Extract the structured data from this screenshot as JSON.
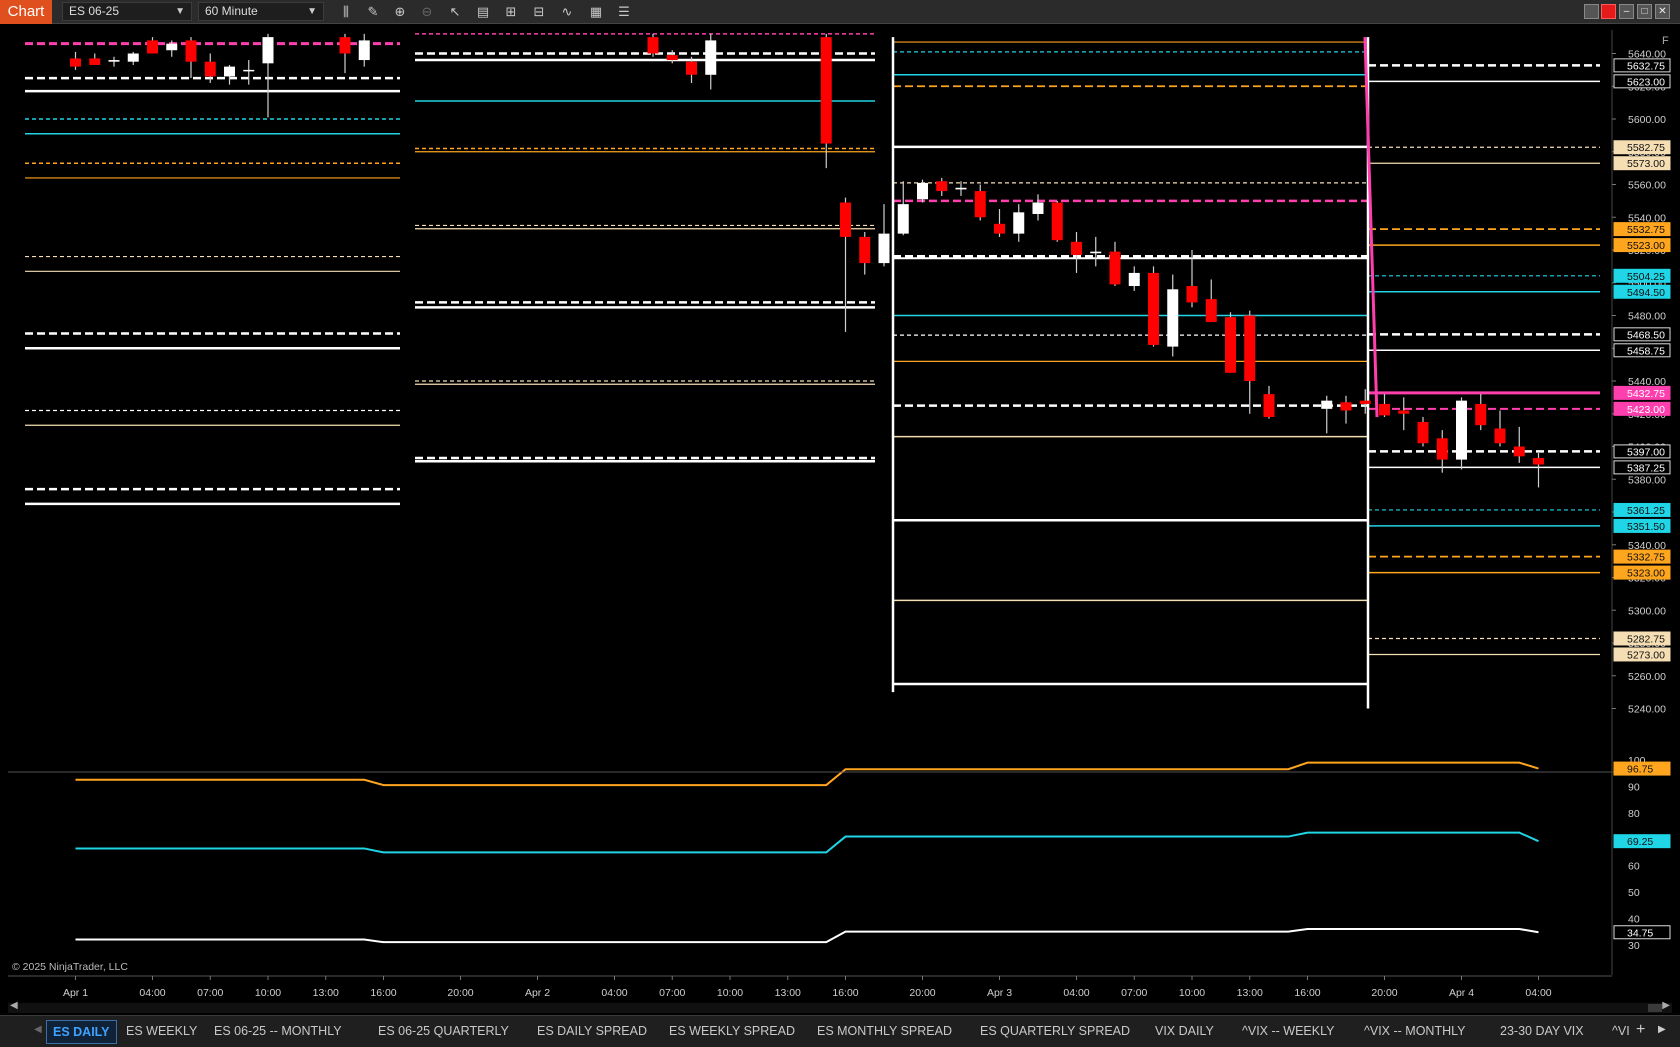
{
  "toolbar": {
    "chart_tab": "Chart",
    "instrument": "ES 06-25",
    "interval": "60 Minute"
  },
  "price_axis": {
    "ticks": [
      "5640.00",
      "5620.00",
      "5600.00",
      "5580.00",
      "5560.00",
      "5540.00",
      "5520.00",
      "5500.00",
      "5480.00",
      "5460.00",
      "5440.00",
      "5420.00",
      "5400.00",
      "5380.00",
      "5360.00",
      "5340.00",
      "5320.00",
      "5300.00",
      "5280.00",
      "5260.00",
      "5240.00"
    ],
    "markers": [
      {
        "label": "5632.75",
        "color": "#ffffff"
      },
      {
        "label": "5623.00",
        "color": "#ffffff"
      },
      {
        "label": "5582.75",
        "color": "#f5deb3"
      },
      {
        "label": "5573.00",
        "color": "#f5deb3"
      },
      {
        "label": "5532.75",
        "color": "#ffa51e"
      },
      {
        "label": "5523.00",
        "color": "#ffa51e"
      },
      {
        "label": "5504.25",
        "color": "#1fd5e6"
      },
      {
        "label": "5494.50",
        "color": "#1fd5e6"
      },
      {
        "label": "5468.50",
        "color": "#ffffff"
      },
      {
        "label": "5458.75",
        "color": "#ffffff"
      },
      {
        "label": "5432.75",
        "color": "#ff3fae"
      },
      {
        "label": "5423.00",
        "color": "#ff3fae"
      },
      {
        "label": "5397.00",
        "color": "#ffffff"
      },
      {
        "label": "5387.25",
        "color": "#ffffff"
      },
      {
        "label": "5361.25",
        "color": "#1fd5e6"
      },
      {
        "label": "5351.50",
        "color": "#1fd5e6"
      },
      {
        "label": "5332.75",
        "color": "#ffa51e"
      },
      {
        "label": "5323.00",
        "color": "#ffa51e"
      },
      {
        "label": "5282.75",
        "color": "#f5deb3"
      },
      {
        "label": "5273.00",
        "color": "#f5deb3"
      }
    ]
  },
  "lower_axis": {
    "ticks": [
      "100",
      "90",
      "80",
      "70",
      "60",
      "50",
      "40",
      "30"
    ],
    "markers": [
      {
        "label": "96.75",
        "color": "#ffa51e"
      },
      {
        "label": "69.25",
        "color": "#1fd5e6"
      },
      {
        "label": "34.75",
        "color": "#ffffff"
      }
    ]
  },
  "time_axis": [
    "Apr 1",
    "04:00",
    "07:00",
    "10:00",
    "13:00",
    "16:00",
    "20:00",
    "Apr 2",
    "04:00",
    "07:00",
    "10:00",
    "13:00",
    "16:00",
    "20:00",
    "Apr 3",
    "04:00",
    "07:00",
    "10:00",
    "13:00",
    "16:00",
    "20:00",
    "Apr 4",
    "04:00"
  ],
  "copyright": "© 2025 NinjaTrader, LLC",
  "corner_flag": "F",
  "bottom_tabs": [
    "ES DAILY",
    "ES WEEKLY",
    "ES 06-25 -- MONTHLY",
    "ES 06-25 QUARTERLY",
    "ES DAILY SPREAD",
    "ES WEEKLY SPREAD",
    "ES MONTHLY SPREAD",
    "ES QUARTERLY SPREAD",
    "VIX DAILY",
    "^VIX -- WEEKLY",
    "^VIX -- MONTHLY",
    "23-30 DAY VIX",
    "^VI"
  ],
  "colors": {
    "bull": "#ffffff",
    "bear": "#ff0000",
    "orange": "#ffa51e",
    "cyan": "#1fd5e6",
    "magenta": "#ff3fae",
    "wheat": "#f5deb3",
    "white": "#ffffff",
    "background": "#000000"
  },
  "chart_data": {
    "type": "candlestick",
    "instrument": "ES 06-25",
    "interval": "60 Minute",
    "ylim": [
      5240,
      5645
    ],
    "x_range": [
      "Apr 1 00:00",
      "Apr 4 05:30"
    ],
    "candles": [
      {
        "t": "Apr 1 00:00",
        "o": 5637,
        "h": 5641,
        "l": 5630,
        "c": 5632
      },
      {
        "t": "Apr 1 01:00",
        "o": 5637,
        "h": 5640,
        "l": 5633,
        "c": 5633
      },
      {
        "t": "Apr 1 02:00",
        "o": 5635,
        "h": 5638,
        "l": 5632,
        "c": 5636
      },
      {
        "t": "Apr 1 03:00",
        "o": 5635,
        "h": 5641,
        "l": 5633,
        "c": 5640
      },
      {
        "t": "Apr 1 04:00",
        "o": 5648,
        "h": 5650,
        "l": 5640,
        "c": 5640
      },
      {
        "t": "Apr 1 05:00",
        "o": 5642,
        "h": 5648,
        "l": 5638,
        "c": 5646
      },
      {
        "t": "Apr 1 06:00",
        "o": 5648,
        "h": 5650,
        "l": 5625,
        "c": 5635
      },
      {
        "t": "Apr 1 07:00",
        "o": 5635,
        "h": 5640,
        "l": 5622,
        "c": 5626
      },
      {
        "t": "Apr 1 08:00",
        "o": 5626,
        "h": 5633,
        "l": 5621,
        "c": 5632
      },
      {
        "t": "Apr 1 09:00",
        "o": 5630,
        "h": 5636,
        "l": 5621,
        "c": 5630
      },
      {
        "t": "Apr 1 10:00",
        "o": 5634,
        "h": 5652,
        "l": 5601,
        "c": 5650
      },
      {
        "t": "Apr 1 14:00",
        "o": 5650,
        "h": 5652,
        "l": 5628,
        "c": 5640
      },
      {
        "t": "Apr 1 15:00",
        "o": 5636,
        "h": 5652,
        "l": 5632,
        "c": 5648
      },
      {
        "t": "Apr 2 06:00",
        "o": 5650,
        "h": 5652,
        "l": 5638,
        "c": 5640
      },
      {
        "t": "Apr 2 07:00",
        "o": 5639,
        "h": 5642,
        "l": 5634,
        "c": 5636
      },
      {
        "t": "Apr 2 08:00",
        "o": 5635,
        "h": 5638,
        "l": 5622,
        "c": 5627
      },
      {
        "t": "Apr 2 09:00",
        "o": 5627,
        "h": 5652,
        "l": 5618,
        "c": 5648
      },
      {
        "t": "Apr 2 15:00",
        "o": 5650,
        "h": 5652,
        "l": 5570,
        "c": 5585
      },
      {
        "t": "Apr 2 16:00",
        "o": 5549,
        "h": 5552,
        "l": 5470,
        "c": 5528
      },
      {
        "t": "Apr 2 17:00",
        "o": 5528,
        "h": 5531,
        "l": 5505,
        "c": 5512
      },
      {
        "t": "Apr 2 18:00",
        "o": 5512,
        "h": 5548,
        "l": 5510,
        "c": 5530
      },
      {
        "t": "Apr 2 19:00",
        "o": 5530,
        "h": 5562,
        "l": 5529,
        "c": 5548
      },
      {
        "t": "Apr 2 20:00",
        "o": 5551,
        "h": 5563,
        "l": 5549,
        "c": 5561
      },
      {
        "t": "Apr 2 21:00",
        "o": 5562,
        "h": 5564,
        "l": 5553,
        "c": 5556
      },
      {
        "t": "Apr 2 22:00",
        "o": 5557,
        "h": 5562,
        "l": 5553,
        "c": 5558
      },
      {
        "t": "Apr 2 23:00",
        "o": 5556,
        "h": 5560,
        "l": 5538,
        "c": 5540
      },
      {
        "t": "Apr 3 00:00",
        "o": 5536,
        "h": 5545,
        "l": 5528,
        "c": 5530
      },
      {
        "t": "Apr 3 01:00",
        "o": 5530,
        "h": 5548,
        "l": 5525,
        "c": 5543
      },
      {
        "t": "Apr 3 02:00",
        "o": 5542,
        "h": 5554,
        "l": 5538,
        "c": 5549
      },
      {
        "t": "Apr 3 03:00",
        "o": 5549,
        "h": 5550,
        "l": 5525,
        "c": 5526
      },
      {
        "t": "Apr 3 04:00",
        "o": 5525,
        "h": 5531,
        "l": 5506,
        "c": 5517
      },
      {
        "t": "Apr 3 05:00",
        "o": 5518,
        "h": 5528,
        "l": 5510,
        "c": 5519
      },
      {
        "t": "Apr 3 06:00",
        "o": 5519,
        "h": 5525,
        "l": 5498,
        "c": 5499
      },
      {
        "t": "Apr 3 07:00",
        "o": 5498,
        "h": 5510,
        "l": 5495,
        "c": 5506
      },
      {
        "t": "Apr 3 08:00",
        "o": 5506,
        "h": 5510,
        "l": 5461,
        "c": 5462
      },
      {
        "t": "Apr 3 09:00",
        "o": 5461,
        "h": 5505,
        "l": 5455,
        "c": 5496
      },
      {
        "t": "Apr 3 10:00",
        "o": 5498,
        "h": 5520,
        "l": 5485,
        "c": 5488
      },
      {
        "t": "Apr 3 11:00",
        "o": 5490,
        "h": 5502,
        "l": 5478,
        "c": 5476
      },
      {
        "t": "Apr 3 12:00",
        "o": 5479,
        "h": 5482,
        "l": 5447,
        "c": 5445
      },
      {
        "t": "Apr 3 13:00",
        "o": 5480,
        "h": 5483,
        "l": 5420,
        "c": 5440
      },
      {
        "t": "Apr 3 14:00",
        "o": 5432,
        "h": 5437,
        "l": 5417,
        "c": 5418
      },
      {
        "t": "Apr 3 17:00",
        "o": 5423,
        "h": 5431,
        "l": 5408,
        "c": 5428
      },
      {
        "t": "Apr 3 18:00",
        "o": 5427,
        "h": 5431,
        "l": 5414,
        "c": 5422
      },
      {
        "t": "Apr 3 19:00",
        "o": 5428,
        "h": 5435,
        "l": 5420,
        "c": 5426
      },
      {
        "t": "Apr 3 20:00",
        "o": 5426,
        "h": 5432,
        "l": 5418,
        "c": 5419
      },
      {
        "t": "Apr 3 21:00",
        "o": 5422,
        "h": 5430,
        "l": 5410,
        "c": 5420
      },
      {
        "t": "Apr 3 22:00",
        "o": 5415,
        "h": 5418,
        "l": 5400,
        "c": 5402
      },
      {
        "t": "Apr 3 23:00",
        "o": 5405,
        "h": 5410,
        "l": 5384,
        "c": 5392
      },
      {
        "t": "Apr 4 00:00",
        "o": 5392,
        "h": 5430,
        "l": 5386,
        "c": 5428
      },
      {
        "t": "Apr 4 01:00",
        "o": 5426,
        "h": 5432,
        "l": 5410,
        "c": 5413
      },
      {
        "t": "Apr 4 02:00",
        "o": 5411,
        "h": 5422,
        "l": 5400,
        "c": 5402
      },
      {
        "t": "Apr 4 03:00",
        "o": 5400,
        "h": 5412,
        "l": 5390,
        "c": 5394
      },
      {
        "t": "Apr 4 04:00",
        "o": 5393,
        "h": 5396,
        "l": 5375,
        "c": 5389
      }
    ],
    "lower_panel": {
      "ylim": [
        28,
        102
      ],
      "series": [
        {
          "color": "#ffa51e",
          "points": [
            [
              "Apr 1 00:00",
              92.5
            ],
            [
              "Apr 1 15:00",
              92.5
            ],
            [
              "Apr 1 16:00",
              90.5
            ],
            [
              "Apr 2 15:00",
              90.5
            ],
            [
              "Apr 2 16:00",
              96.5
            ],
            [
              "Apr 3 15:00",
              96.5
            ],
            [
              "Apr 3 16:00",
              99
            ],
            [
              "Apr 4 03:00",
              99
            ],
            [
              "Apr 4 04:00",
              96.75
            ]
          ]
        },
        {
          "color": "#1fd5e6",
          "points": [
            [
              "Apr 1 00:00",
              66.5
            ],
            [
              "Apr 1 15:00",
              66.5
            ],
            [
              "Apr 1 16:00",
              65
            ],
            [
              "Apr 2 15:00",
              65
            ],
            [
              "Apr 2 16:00",
              71
            ],
            [
              "Apr 3 15:00",
              71
            ],
            [
              "Apr 3 16:00",
              72.5
            ],
            [
              "Apr 4 03:00",
              72.5
            ],
            [
              "Apr 4 04:00",
              69.25
            ]
          ]
        },
        {
          "color": "#ffffff",
          "points": [
            [
              "Apr 1 00:00",
              32
            ],
            [
              "Apr 1 15:00",
              32
            ],
            [
              "Apr 1 16:00",
              31
            ],
            [
              "Apr 2 15:00",
              31
            ],
            [
              "Apr 2 16:00",
              35
            ],
            [
              "Apr 3 15:00",
              35
            ],
            [
              "Apr 3 16:00",
              36
            ],
            [
              "Apr 4 03:00",
              36
            ],
            [
              "Apr 4 04:00",
              34.75
            ]
          ]
        }
      ]
    }
  }
}
